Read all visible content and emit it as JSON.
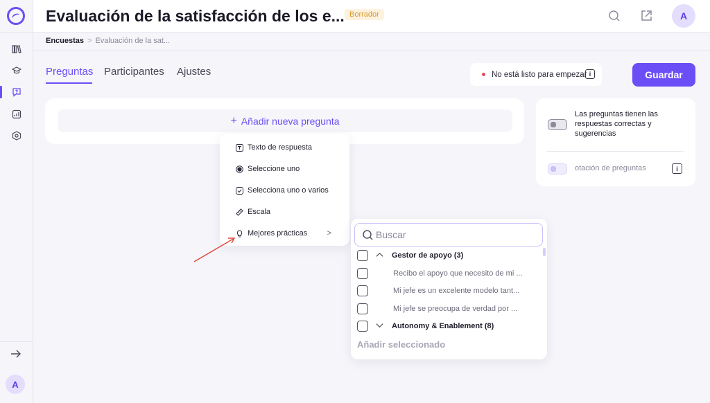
{
  "header": {
    "title": "Evaluación de la satisfacción de los e...",
    "status_badge": "Borrador",
    "avatar_initial": "A"
  },
  "sidebar": {
    "items": [
      {
        "icon": "library-icon"
      },
      {
        "icon": "graduation-cap-icon"
      },
      {
        "icon": "survey-icon",
        "active": true
      },
      {
        "icon": "analytics-icon"
      },
      {
        "icon": "settings-hexagon-icon"
      }
    ],
    "avatar_initial": "A"
  },
  "breadcrumb": {
    "root": "Encuestas",
    "separator": ">",
    "current": "Evaluación de la sat..."
  },
  "tabs": [
    {
      "label": "Preguntas",
      "active": true
    },
    {
      "label": "Participantes"
    },
    {
      "label": "Ajustes"
    }
  ],
  "readiness": {
    "label": "No está listo para empezar",
    "info": "i"
  },
  "save_label": "Guardar",
  "add_question_label": "Añadir nueva pregunta",
  "settings_card": {
    "correct_answers_label": "Las preguntas tienen las respuestas correctas y sugerencias",
    "rotation_label": "otación de preguntas",
    "info": "i"
  },
  "question_types": [
    {
      "label": "Texto de respuesta",
      "icon": "text-box-icon"
    },
    {
      "label": "Seleccione uno",
      "icon": "radio-icon"
    },
    {
      "label": "Selecciona uno o varios",
      "icon": "checkbox-icon"
    },
    {
      "label": "Escala",
      "icon": "ruler-icon"
    },
    {
      "label": "Mejores prácticas",
      "icon": "lightbulb-icon",
      "submenu": true
    }
  ],
  "best_practices": {
    "search_placeholder": "Buscar",
    "rows": [
      {
        "type": "group",
        "label": "Gestor de apoyo (3)",
        "expanded": true
      },
      {
        "type": "question",
        "label": "Recibo el apoyo que necesito de mi ..."
      },
      {
        "type": "question",
        "label": "Mi jefe es un excelente modelo tant..."
      },
      {
        "type": "question",
        "label": "Mi jefe se preocupa de verdad por ..."
      },
      {
        "type": "group",
        "label": "Autonomy & Enablement (8)",
        "expanded": false
      }
    ],
    "add_selected_label": "Añadir seleccionado"
  },
  "colors": {
    "accent": "#6b4ef6",
    "badge_text": "#d79a2b",
    "badge_bg": "#fdf2dd",
    "status_dot": "#e8485c",
    "annotation_arrow": "#e0483a"
  }
}
